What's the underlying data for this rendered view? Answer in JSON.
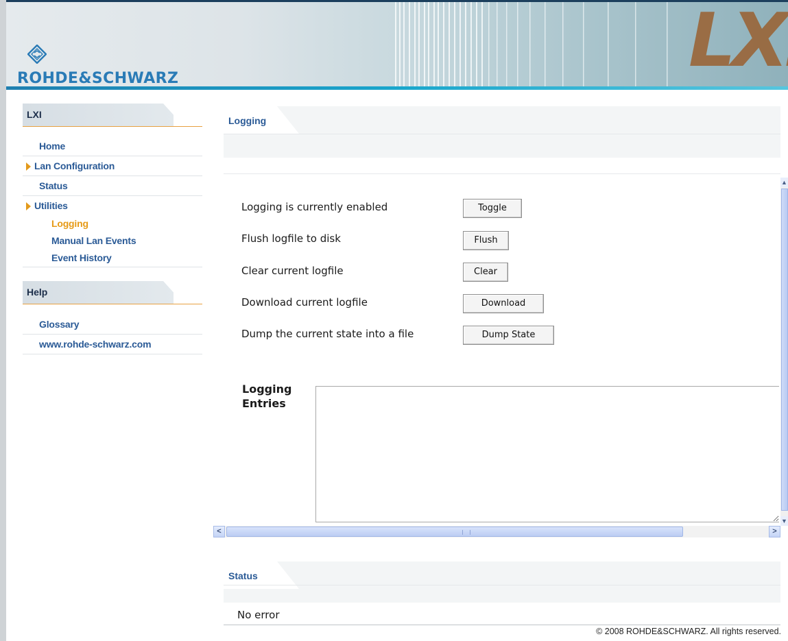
{
  "header": {
    "brand": "ROHDE&SCHWARZ",
    "lxi_logo": "LXI"
  },
  "sidebar": {
    "lxi_section": {
      "title": "LXI",
      "items": [
        {
          "label": "Home",
          "has_arrow": false
        },
        {
          "label": "Lan Configuration",
          "has_arrow": true
        },
        {
          "label": "Status",
          "has_arrow": false
        },
        {
          "label": "Utilities",
          "has_arrow": true
        }
      ],
      "subitems": [
        {
          "label": "Logging",
          "active": true
        },
        {
          "label": "Manual Lan Events",
          "active": false
        },
        {
          "label": "Event History",
          "active": false
        }
      ]
    },
    "help_section": {
      "title": "Help",
      "items": [
        {
          "label": "Glossary"
        },
        {
          "label": "www.rohde-schwarz.com"
        }
      ]
    }
  },
  "main": {
    "section_title": "Logging",
    "rows": [
      {
        "label": "Logging is currently enabled",
        "button": "Toggle"
      },
      {
        "label": "Flush logfile to disk",
        "button": "Flush"
      },
      {
        "label": "Clear current logfile",
        "button": "Clear"
      },
      {
        "label": "Download current logfile",
        "button": "Download"
      },
      {
        "label": "Dump the current state into a file",
        "button": "Dump State"
      }
    ],
    "log_label": "Logging Entries",
    "log_value": ""
  },
  "status": {
    "section_title": "Status",
    "message": "No error"
  },
  "footer": {
    "copyright": "© 2008 ROHDE&SCHWARZ. All rights reserved."
  },
  "colors": {
    "link": "#2a5a96",
    "active": "#e69a17",
    "accent_line": "#e7a040",
    "brand_blue": "#2a7bb6"
  }
}
